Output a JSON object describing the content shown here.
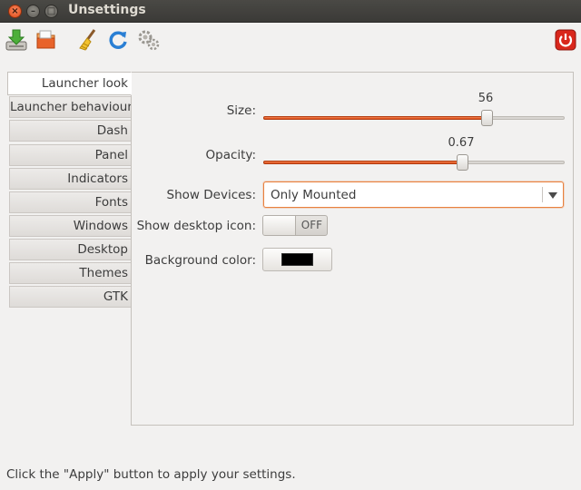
{
  "window": {
    "title": "Unsettings",
    "controls": {
      "close": "×",
      "minimize": "–",
      "maximize": "□"
    }
  },
  "toolbar": {
    "icons": [
      "download-icon",
      "folder-icon",
      "broom-icon",
      "refresh-icon",
      "gears-icon",
      "power-icon"
    ]
  },
  "tabs": [
    {
      "label": "Launcher look",
      "active": true
    },
    {
      "label": "Launcher behaviour"
    },
    {
      "label": "Dash"
    },
    {
      "label": "Panel"
    },
    {
      "label": "Indicators"
    },
    {
      "label": "Fonts"
    },
    {
      "label": "Windows"
    },
    {
      "label": "Desktop"
    },
    {
      "label": "Themes"
    },
    {
      "label": "GTK"
    }
  ],
  "settings": {
    "size": {
      "label": "Size:",
      "value": "56",
      "fraction": 0.74
    },
    "opacity": {
      "label": "Opacity:",
      "value": "0.67",
      "fraction": 0.66
    },
    "show_devices": {
      "label": "Show Devices:",
      "selected": "Only Mounted"
    },
    "show_desktop_icon": {
      "label": "Show desktop icon:",
      "state": "OFF"
    },
    "background_color": {
      "label": "Background color:",
      "color": "#000000"
    }
  },
  "status": "Click the \"Apply\" button to apply your settings.",
  "colors": {
    "accent": "#dd4814",
    "window_bg": "#f2f1f0",
    "titlebar": "#3c3b37"
  }
}
